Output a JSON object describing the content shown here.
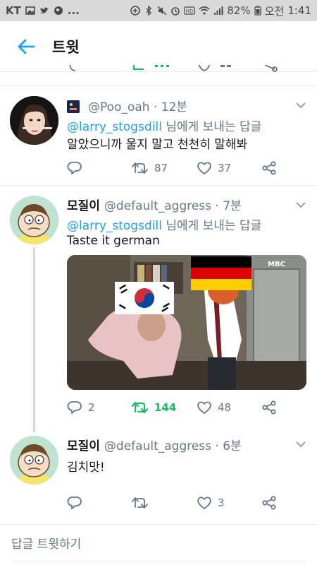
{
  "status_bar": {
    "carrier": "KT",
    "dots": "...",
    "battery": "82%",
    "ampm": "오전",
    "time": "1:41"
  },
  "header": {
    "title": "트윗"
  },
  "tweets": [
    {
      "display_name": "",
      "handle": "@Poo_oah",
      "time": "12분",
      "reply_mention": "@larry_stogsdill",
      "reply_suffix": " 님에게 보내는 답글",
      "text": "알았으니까 울지 말고 천천히 말해봐",
      "replies": "",
      "retweets": "87",
      "likes": "37"
    },
    {
      "display_name": "모질이",
      "handle": "@default_aggress",
      "time": "7분",
      "reply_mention": "@larry_stogsdill",
      "reply_suffix": " 님에게 보내는 답글",
      "text": "Taste it german",
      "replies": "2",
      "retweets": "144",
      "likes": "48",
      "media_watermark": "MBC"
    },
    {
      "display_name": "모질이",
      "handle": "@default_aggress",
      "time": "6분",
      "text": "김치맛!",
      "replies": "",
      "retweets": "",
      "likes": "3"
    }
  ],
  "reply_bar": {
    "placeholder": "답글 트윗하기"
  },
  "colors": {
    "accent": "#1da1f2",
    "retweet_active": "#17bf63",
    "text_secondary": "#657786",
    "divider": "#e6ecf0"
  },
  "icons": [
    "back-arrow-icon",
    "reply-icon",
    "retweet-icon",
    "like-icon",
    "share-icon",
    "chevron-down-icon"
  ]
}
